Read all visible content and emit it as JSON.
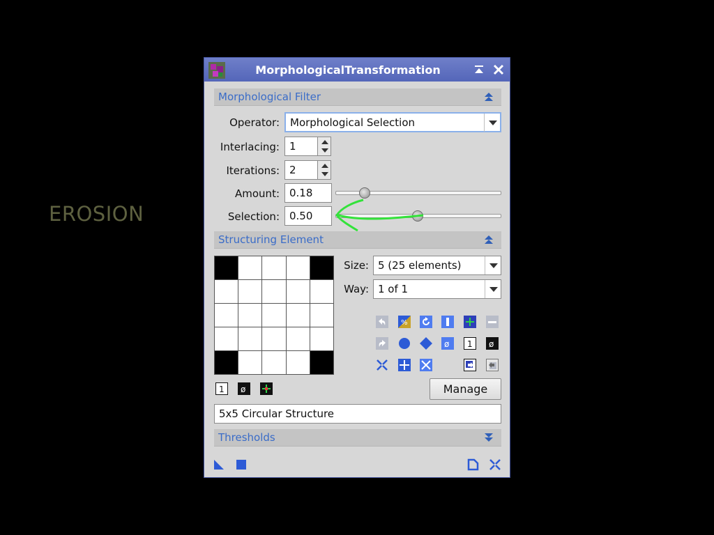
{
  "side_label": "EROSION",
  "window": {
    "title": "MorphologicalTransformation"
  },
  "morph_filter": {
    "section_title": "Morphological Filter",
    "operator_label": "Operator:",
    "operator_value": "Morphological Selection",
    "interlacing_label": "Interlacing:",
    "interlacing_value": "1",
    "iterations_label": "Iterations:",
    "iterations_value": "2",
    "amount_label": "Amount:",
    "amount_value": "0.18",
    "amount_slider": 0.18,
    "selection_label": "Selection:",
    "selection_value": "0.50",
    "selection_slider": 0.5
  },
  "structuring": {
    "section_title": "Structuring Element",
    "size_label": "Size:",
    "size_value": "5  (25 elements)",
    "way_label": "Way:",
    "way_value": "1 of 1",
    "grid": [
      [
        1,
        0,
        0,
        0,
        1
      ],
      [
        0,
        0,
        0,
        0,
        0
      ],
      [
        0,
        0,
        0,
        0,
        0
      ],
      [
        0,
        0,
        0,
        0,
        0
      ],
      [
        1,
        0,
        0,
        0,
        1
      ]
    ],
    "manage_label": "Manage",
    "name_value": "5x5 Circular Structure"
  },
  "thresholds": {
    "section_title": "Thresholds"
  },
  "colors": {
    "title_bar": "#5a6bbd",
    "section_title": "#3a6cc8",
    "annotation_arrow": "#33e23a"
  }
}
